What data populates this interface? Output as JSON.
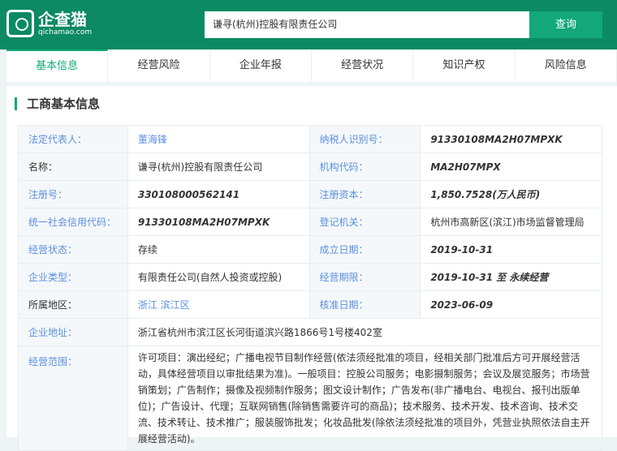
{
  "header": {
    "logo_cn": "企查猫",
    "logo_en": "qichamao.com",
    "search_value": "谦寻(杭州)控股有限责任公司",
    "search_button": "查询"
  },
  "tabs": [
    "基本信息",
    "经营风险",
    "企业年报",
    "经营状况",
    "知识产权",
    "风险信息"
  ],
  "section_title": "工商基本信息",
  "rows": [
    {
      "l1": "法定代表人：",
      "v1": "董海锋",
      "l2": "纳税人识别号：",
      "v2": "91330108MA2H07MPXK"
    },
    {
      "l1": "名称：",
      "v1": "谦寻(杭州)控股有限责任公司",
      "l2": "机构代码：",
      "v2": "MA2H07MPX"
    },
    {
      "l1": "注册号：",
      "v1": "330108000562141",
      "l2": "注册资本：",
      "v2": "1,850.7528(万人民币)"
    },
    {
      "l1": "统一社会信用代码：",
      "v1": "91330108MA2H07MPXK",
      "l2": "登记机关：",
      "v2": "杭州市高新区(滨江)市场监督管理局"
    },
    {
      "l1": "经营状态：",
      "v1": "存续",
      "l2": "成立日期：",
      "v2": "2019-10-31"
    },
    {
      "l1": "企业类型：",
      "v1": "有限责任公司(自然人投资或控股)",
      "l2": "经营期限：",
      "v2": "2019-10-31 至 永续经营"
    },
    {
      "l1": "所属地区：",
      "v1": "浙江 滨江区",
      "l2": "核准日期：",
      "v2": "2023-06-09"
    }
  ],
  "address": {
    "label": "企业地址：",
    "value": "浙江省杭州市滨江区长河街道滨兴路1866号1号楼402室"
  },
  "scope": {
    "label": "经营范围：",
    "value": "许可项目：演出经纪；广播电视节目制作经营(依法须经批准的项目，经相关部门批准后方可开展经营活动，具体经营项目以审批结果为准)。一般项目：控股公司服务；电影摄制服务；会议及展览服务；市场营销策划；广告制作；摄像及视频制作服务；图文设计制作；广告发布(非广播电台、电视台、报刊出版单位)；广告设计、代理；互联网销售(除销售需要许可的商品)；技术服务、技术开发、技术咨询、技术交流、技术转让、技术推广；服装服饰批发；化妆品批发(除依法须经批准的项目外，凭营业执照依法自主开展经营活动)。"
  }
}
